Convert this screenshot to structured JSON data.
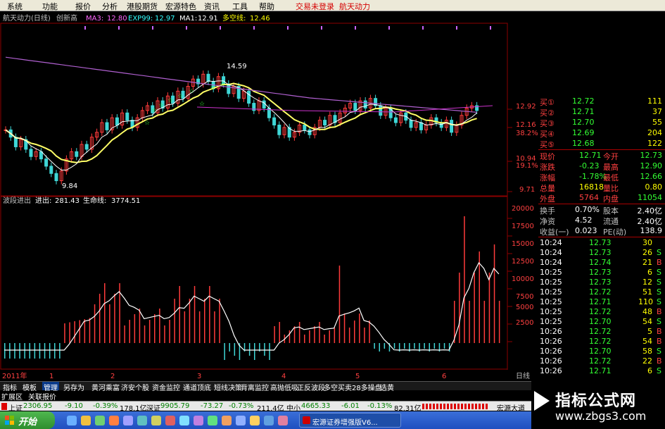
{
  "menubar": {
    "items": [
      "系统",
      "功能",
      "报价",
      "分析",
      "港股期货",
      "宏源特色",
      "资讯",
      "工具",
      "帮助"
    ],
    "notice": "交易未登录",
    "stock": "航天动力"
  },
  "chart_header": {
    "name": "航天动力(日线)",
    "note": "创新高",
    "ma3_label": "MA3:",
    "ma3": "12.80",
    "exp99_label": "EXP99:",
    "exp99": "12.97",
    "ma1_label": "MA1:",
    "ma1": "12.91",
    "dkx_label": "多空线:",
    "dkx": "12.46"
  },
  "price_labels": {
    "high_mark": "14.59",
    "low_mark": "9.84",
    "axis": [
      "12.92",
      "12.16",
      "38.2%",
      "10.94",
      "19.1%",
      "9.71"
    ]
  },
  "indicator_header": {
    "name": "波段进出",
    "in_label": "进出:",
    "in_value": "281.43",
    "life_label": "生命线:",
    "life_value": "3774.51"
  },
  "volume_axis": [
    "20000",
    "17500",
    "15000",
    "12500",
    "10000",
    "7500",
    "5000",
    "2500"
  ],
  "x_axis": {
    "year": "2011年",
    "months": [
      "1",
      "2",
      "3",
      "4",
      "5",
      "6"
    ],
    "period": "日线"
  },
  "colors": {
    "up": "#ff3b3b",
    "down": "#3fd6d6",
    "ma_yellow": "#ffff66",
    "ma_purple": "#b060d0",
    "ma_white": "#ffffff",
    "grid": "#8b0000"
  },
  "quote": {
    "bids": [
      {
        "label": "买①",
        "price": "12.72",
        "vol": "111"
      },
      {
        "label": "买②",
        "price": "12.71",
        "vol": "37"
      },
      {
        "label": "买③",
        "price": "12.70",
        "vol": "55"
      },
      {
        "label": "买④",
        "price": "12.69",
        "vol": "204"
      },
      {
        "label": "买⑤",
        "price": "12.68",
        "vol": "122"
      }
    ],
    "stats": [
      {
        "l1": "现价",
        "v1": "12.71",
        "l2": "今开",
        "v2": "12.73"
      },
      {
        "l1": "涨跌",
        "v1": "-0.23",
        "l2": "最高",
        "v2": "12.90"
      },
      {
        "l1": "涨幅",
        "v1": "-1.78%",
        "l2": "最低",
        "v2": "12.66"
      },
      {
        "l1": "总量",
        "v1": "16818",
        "l2": "量比",
        "v2": "0.80"
      },
      {
        "l1": "外盘",
        "v1": "5764",
        "l2": "内盘",
        "v2": "11054"
      }
    ],
    "stats2": [
      {
        "l1": "换手",
        "v1": "0.70%",
        "l2": "股本",
        "v2": "2.40亿"
      },
      {
        "l1": "净资",
        "v1": "4.52",
        "l2": "流通",
        "v2": "2.40亿"
      },
      {
        "l1": "收益(一)",
        "v1": "0.023",
        "l2": "PE(动)",
        "v2": "138.9"
      }
    ],
    "ticks": [
      {
        "t": "10:24",
        "p": "12.73",
        "v": "30",
        "d": ""
      },
      {
        "t": "10:24",
        "p": "12.73",
        "v": "26",
        "d": "S"
      },
      {
        "t": "10:24",
        "p": "12.74",
        "v": "21",
        "d": "B"
      },
      {
        "t": "10:25",
        "p": "12.73",
        "v": "6",
        "d": "S"
      },
      {
        "t": "10:25",
        "p": "12.73",
        "v": "12",
        "d": "S"
      },
      {
        "t": "10:25",
        "p": "12.72",
        "v": "51",
        "d": "S"
      },
      {
        "t": "10:25",
        "p": "12.71",
        "v": "110",
        "d": "S"
      },
      {
        "t": "10:25",
        "p": "12.72",
        "v": "48",
        "d": "B"
      },
      {
        "t": "10:25",
        "p": "12.70",
        "v": "54",
        "d": "S"
      },
      {
        "t": "10:26",
        "p": "12.72",
        "v": "5",
        "d": "B"
      },
      {
        "t": "10:26",
        "p": "12.72",
        "v": "54",
        "d": "B"
      },
      {
        "t": "10:26",
        "p": "12.70",
        "v": "58",
        "d": "S"
      },
      {
        "t": "10:26",
        "p": "12.72",
        "v": "22",
        "d": "B"
      },
      {
        "t": "10:26",
        "p": "12.71",
        "v": "6",
        "d": "S"
      }
    ]
  },
  "tabs": [
    "指标",
    "模板",
    "管理",
    "另存为",
    "黄河乘富",
    "济安个股",
    "资金监控",
    "通道顶底",
    "短线决策",
    "背离监控",
    "高抛低吸",
    "正反波段",
    "多空买卖",
    "28多操盘",
    "选黄"
  ],
  "subtabs": [
    "扩展区",
    "关联报价"
  ],
  "status": {
    "sh_label": "上证",
    "sh": "2306.95",
    "sh_chg": "-9.10",
    "sh_pct": "-0.39%",
    "sh_amt": "178.1亿",
    "sz_label": "深证",
    "sz": "9905.79",
    "sz_chg": "-73.27",
    "sz_pct": "-0.73%",
    "sz_amt": "211.4亿",
    "zx_label": "中小",
    "zx": "4665.33",
    "zx_chg": "-6.01",
    "zx_pct": "-0.13%",
    "zx_amt": "82.31亿",
    "broker": "宏源大道"
  },
  "taskbar": {
    "start": "开始",
    "task": "宏源证券增强版V6..."
  },
  "watermark": {
    "title": "指标公式网",
    "url": "www.zbgs3.com"
  }
}
